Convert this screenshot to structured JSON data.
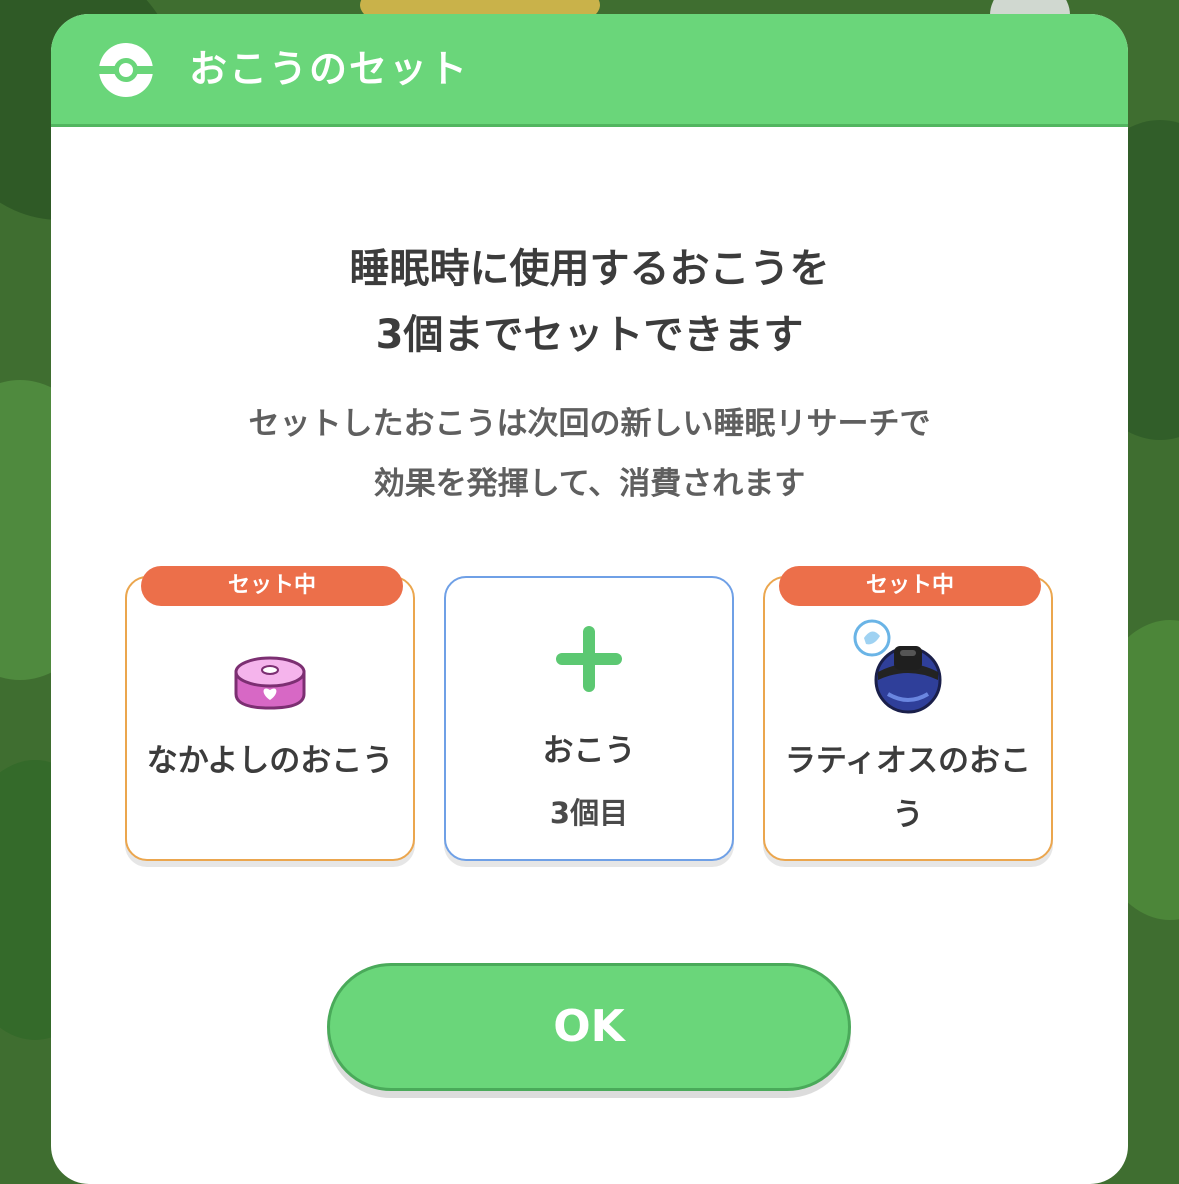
{
  "dialog": {
    "title": "おこうのセット",
    "headline_line1": "睡眠時に使用するおこうを",
    "headline_line2": "3個までセットできます",
    "desc_line1": "セットしたおこうは次回の新しい睡眠リサーチで",
    "desc_line2": "効果を発揮して、消費されます"
  },
  "slots": [
    {
      "badge": "セット中",
      "name": "なかよしのおこう",
      "icon": "pink-incense-icon"
    },
    {
      "name": "おこう",
      "count": "3個目",
      "icon": "plus-icon"
    },
    {
      "badge": "セット中",
      "name": "ラティオスのおこう",
      "icon": "latios-incense-icon"
    }
  ],
  "ok_label": "OK",
  "colors": {
    "header": "#6ad67a",
    "badge": "#ec6f4a",
    "set_border": "#eba64e",
    "empty_border": "#6fa0e6",
    "plus": "#5cc872"
  }
}
